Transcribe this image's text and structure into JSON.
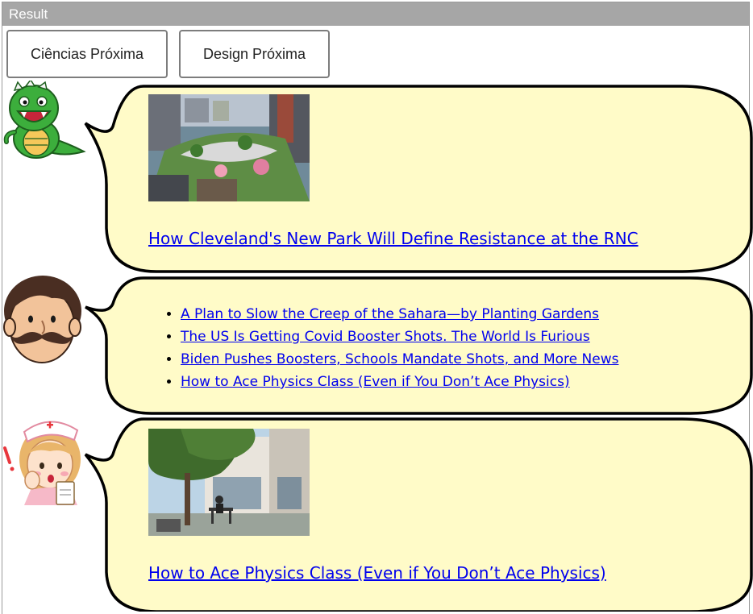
{
  "panel": {
    "title": "Result"
  },
  "buttons": {
    "ciencias_label": "Ciências Próxima",
    "design_label": "Design Próxima"
  },
  "colors": {
    "bubble_fill": "#fffbc8",
    "link": "#0000ee",
    "header_bar": "#a6a6a6"
  },
  "conversation": {
    "monster": {
      "avatar": "green-dinosaur-monster-icon",
      "image_alt": "Aerial view of Cleveland public square park",
      "link_text": "How Cleveland's New Park Will Define Resistance at the RNC"
    },
    "man": {
      "avatar": "mustache-man-icon",
      "links": [
        "A Plan to Slow the Creep of the Sahara—by Planting Gardens",
        "The US Is Getting Covid Booster Shots. The World Is Furious",
        "Biden Pushes Boosters, Schools Mandate Shots, and More News",
        "How to Ace Physics Class (Even if You Don’t Ace Physics)"
      ]
    },
    "nurse": {
      "avatar": "surprised-nurse-icon",
      "image_alt": "Student studying at outdoor table under a tree",
      "link_text": "How to Ace Physics Class (Even if You Don’t Ace Physics)"
    }
  }
}
